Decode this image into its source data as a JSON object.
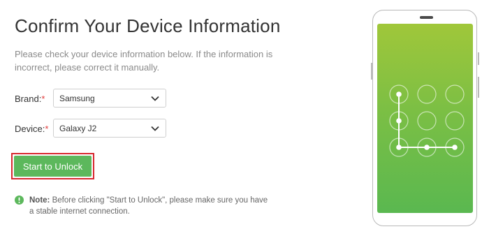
{
  "title": "Confirm Your Device Information",
  "description": "Please check your device information below. If the information is incorrect, please correct it manually.",
  "brand": {
    "label": "Brand:",
    "required_mark": "*",
    "value": "Samsung"
  },
  "device": {
    "label": "Device:",
    "required_mark": "*",
    "value": "Galaxy J2"
  },
  "start_button": "Start to Unlock",
  "note": {
    "label": "Note:",
    "text": " Before clicking \"Start to Unlock\", please make sure you have a stable internet connection."
  },
  "icons": [
    "chevron-down-icon",
    "info-icon",
    "phone-illustration",
    "unlock-pattern"
  ],
  "colors": {
    "accent": "#5cb85c",
    "highlight_border": "#d7282f",
    "required": "#e23b3b",
    "screen_top": "#a0c73a",
    "screen_bottom": "#5ab850"
  }
}
